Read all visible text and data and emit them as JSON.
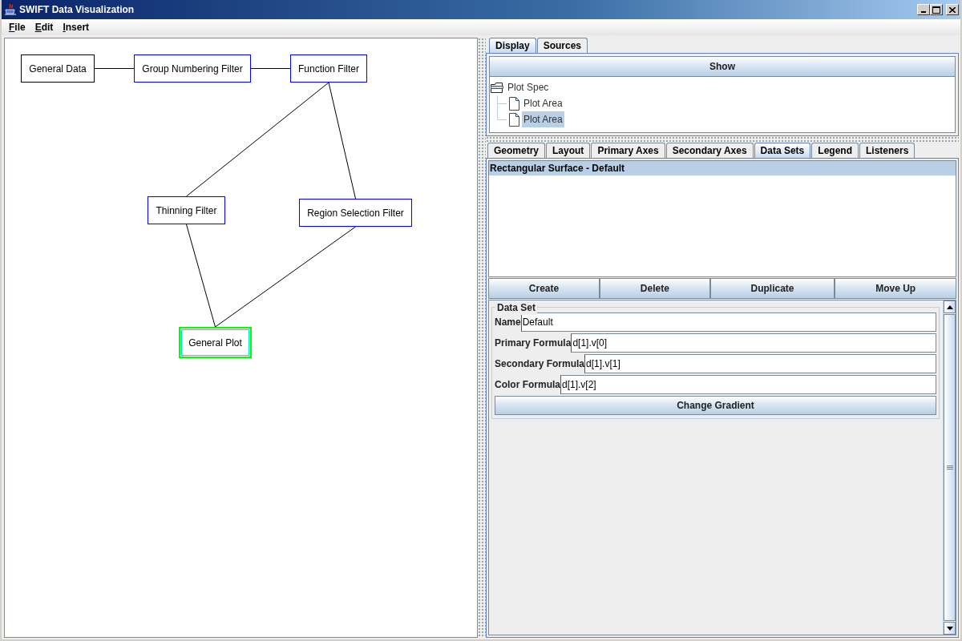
{
  "window": {
    "title": "SWIFT Data Visualization"
  },
  "menu": [
    {
      "label": "File"
    },
    {
      "label": "Edit"
    },
    {
      "label": "Insert"
    }
  ],
  "diagram": {
    "nodes": [
      {
        "label": "General Data",
        "kind": "data",
        "selected": false
      },
      {
        "label": "Group Numbering Filter",
        "kind": "filter",
        "selected": false
      },
      {
        "label": "Function Filter",
        "kind": "filter",
        "selected": false
      },
      {
        "label": "Thinning Filter",
        "kind": "filter",
        "selected": false
      },
      {
        "label": "Region Selection Filter",
        "kind": "filter",
        "selected": false
      },
      {
        "label": "General Plot",
        "kind": "plot",
        "selected": true
      }
    ]
  },
  "right_tabs": [
    {
      "label": "Display",
      "selected": true
    },
    {
      "label": "Sources",
      "selected": false
    }
  ],
  "show_button": "Show",
  "tree": {
    "label": "Plot Spec",
    "selected": false,
    "children": [
      {
        "label": "Plot Area",
        "selected": false
      },
      {
        "label": "Plot Area",
        "selected": true
      }
    ]
  },
  "sub_tabs": [
    {
      "label": "Geometry",
      "selected": false
    },
    {
      "label": "Layout",
      "selected": false
    },
    {
      "label": "Primary Axes",
      "selected": false
    },
    {
      "label": "Secondary Axes",
      "selected": false
    },
    {
      "label": "Data Sets",
      "selected": true
    },
    {
      "label": "Legend",
      "selected": false
    },
    {
      "label": "Listeners",
      "selected": false
    }
  ],
  "data_sets": [
    {
      "label": "Rectangular Surface - Default",
      "selected": true
    }
  ],
  "list_buttons": [
    "Create",
    "Delete",
    "Duplicate",
    "Move Up"
  ],
  "data_set_form": {
    "legend": "Data Set",
    "fields": [
      {
        "label": "Name",
        "value": "Default"
      },
      {
        "label": "Primary Formula",
        "value": "d[1].v[0]"
      },
      {
        "label": "Secondary Formula",
        "value": "d[1].v[1]"
      },
      {
        "label": "Color Formula",
        "value": "d[1].v[2]"
      }
    ],
    "button": "Change Gradient"
  }
}
